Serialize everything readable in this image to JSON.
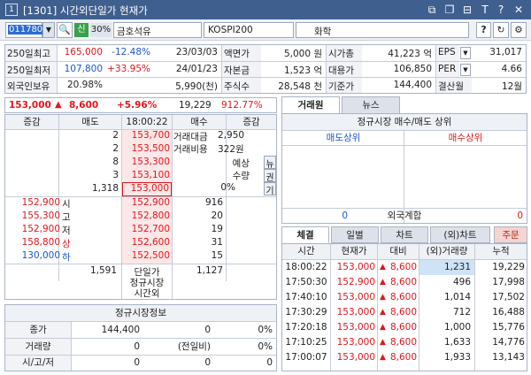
{
  "window": {
    "title": "[1301] 시간외단일가 현재가",
    "controls": [
      "⧉",
      "❐",
      "⊟",
      "T",
      "?",
      "✕"
    ]
  },
  "toolbar": {
    "code": "011780",
    "badge": "신",
    "ratio": "30%",
    "name": "금호석유",
    "market": "KOSPI200",
    "sector": "화학",
    "btn_q": "?"
  },
  "info": {
    "rows": [
      {
        "l1": "250일최고",
        "v1": "165,000",
        "p1": "-12.48%",
        "d1": "23/03/03",
        "l2": "액면가",
        "v2": "5,000 원",
        "l3": "시가총",
        "v3": "41,223 억",
        "l4": "EPS",
        "v4": "31,017"
      },
      {
        "l1": "250일최저",
        "v1": "107,800",
        "p1": "+33.95%",
        "d1": "24/01/23",
        "l2": "자본금",
        "v2": "1,523 억",
        "l3": "대용가",
        "v3": "106,850",
        "l4": "PER",
        "v4": "4.66"
      },
      {
        "l1": "외국인보유",
        "v1": "20.98%",
        "p1": "",
        "d1": "5,990(천)",
        "l2": "주식수",
        "v2": "28,548 천",
        "l3": "기준가",
        "v3": "144,400",
        "l4": "결산월",
        "v4": "12월"
      }
    ]
  },
  "price": {
    "current": "153,000",
    "change": "8,600",
    "rate": "+5.96%",
    "volume": "19,229",
    "vratio": "912.77%"
  },
  "orderbook": {
    "head": [
      "증감",
      "매도",
      "18:00:22",
      "매수",
      "증감"
    ],
    "asks": [
      {
        "qty": "2",
        "price": "153,700"
      },
      {
        "qty": "2",
        "price": "153,500"
      },
      {
        "qty": "8",
        "price": "153,300"
      },
      {
        "qty": "3",
        "price": "153,100"
      },
      {
        "qty": "1,318",
        "price": "153,000"
      }
    ],
    "ask_info": {
      "a_l": "거래대금",
      "a_v": "2,950",
      "b_l": "거래비용",
      "b_v": "322원",
      "c": "예상",
      "d": "수량",
      "e": "0%"
    },
    "side_tabs": [
      "뉴",
      "권",
      "기"
    ],
    "bids": [
      {
        "price": "152,900",
        "qty": "916"
      },
      {
        "price": "152,800",
        "qty": "20"
      },
      {
        "price": "152,700",
        "qty": "19"
      },
      {
        "price": "152,600",
        "qty": "31"
      },
      {
        "price": "152,500",
        "qty": "15"
      }
    ],
    "left_info": [
      {
        "v": "152,900",
        "t": "시"
      },
      {
        "v": "155,300",
        "t": "고"
      },
      {
        "v": "152,900",
        "t": "저"
      },
      {
        "v": "158,800",
        "t": "상"
      },
      {
        "v": "130,000",
        "t": "하"
      }
    ],
    "total_ask": "1,591",
    "total_label": "단일가",
    "total_bid": "1,127",
    "foot1": "정규시장",
    "foot2": "시간외"
  },
  "regular": {
    "title": "정규시장정보",
    "rows": [
      {
        "l": "종가",
        "a": "144,400",
        "b": "0",
        "c": "0%"
      },
      {
        "l": "거래량",
        "a": "0",
        "b": "(전일비)",
        "c": "0%"
      },
      {
        "l": "시/고/저",
        "a": "0",
        "b": "0",
        "c": "0"
      }
    ]
  },
  "right": {
    "tabs": [
      "거래원",
      "뉴스"
    ],
    "top_title": "정규시장 매수/매도 상위",
    "sell_h": "매도상위",
    "buy_h": "매수상위",
    "foreign": "외국계합",
    "f_sell": "0",
    "f_buy": "0",
    "tabs2": [
      "체결",
      "일별",
      "차트",
      "(외)차트",
      "주문"
    ],
    "cols": [
      "시간",
      "현재가",
      "대비",
      "(외)거래량",
      "누적"
    ],
    "trades": [
      {
        "t": "18:00:22",
        "p": "153,000",
        "d": "8,600",
        "v": "1,231",
        "c": "19,229"
      },
      {
        "t": "17:50:30",
        "p": "152,900",
        "d": "8,600",
        "v": "496",
        "c": "17,998"
      },
      {
        "t": "17:40:10",
        "p": "153,000",
        "d": "8,600",
        "v": "1,014",
        "c": "17,502"
      },
      {
        "t": "17:30:29",
        "p": "153,000",
        "d": "8,600",
        "v": "712",
        "c": "16,488"
      },
      {
        "t": "17:20:18",
        "p": "153,000",
        "d": "8,600",
        "v": "1,000",
        "c": "15,776"
      },
      {
        "t": "17:10:25",
        "p": "153,000",
        "d": "8,600",
        "v": "1,633",
        "c": "14,776"
      },
      {
        "t": "17:00:07",
        "p": "153,000",
        "d": "8,600",
        "v": "1,933",
        "c": "13,143"
      }
    ]
  }
}
